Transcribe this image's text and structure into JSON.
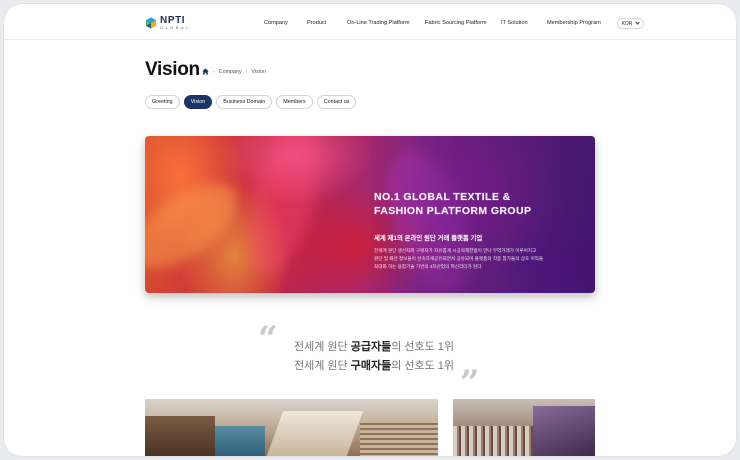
{
  "logo": {
    "name": "NPTI",
    "tagline": "GLOBAL"
  },
  "nav": {
    "items": [
      {
        "label": "Company"
      },
      {
        "label": "Product"
      },
      {
        "label": "On-Line Trading Platform"
      },
      {
        "label": "Fabric Sourcing Platform"
      },
      {
        "label": "IT Solution"
      },
      {
        "label": "Membership Program"
      }
    ],
    "language": "KOR"
  },
  "page": {
    "title": "Vision",
    "breadcrumb": [
      "Company",
      "Vision"
    ]
  },
  "tabs": [
    {
      "label": "Greeting",
      "active": false
    },
    {
      "label": "Vision",
      "active": true
    },
    {
      "label": "Business Domain",
      "active": false
    },
    {
      "label": "Members",
      "active": false
    },
    {
      "label": "Contact us",
      "active": false
    }
  ],
  "hero": {
    "title_line1": "NO.1 GLOBAL TEXTILE &",
    "title_line2": "FASHION PLATFORM GROUP",
    "subtitle": "세계 제1의 온라인 원단 거래 플랫폼 기업",
    "desc_line1": "전세계 원단 생산자와 구매자가 자유롭게 시공의제한없이 만나 무역거래가 이루어지고",
    "desc_line2": "원단 및 패션 정보들이 신속하게공유되면서 공유되며 플랫폼의 각종 참가들의 상호 이익을",
    "desc_line3": "최대화 하는 융합기술 기반의 4차산업의 혁신리더가 된다"
  },
  "quote": {
    "open_mark": "“",
    "close_mark": "”",
    "line1_prefix": "전세계 원단 ",
    "line1_bold": "공급자들",
    "line1_suffix": "의 선호도 1위",
    "line2_prefix": "전세계 원단 ",
    "line2_bold": "구매자들",
    "line2_suffix": "의 선호도 1위"
  },
  "colors": {
    "brand_navy": "#1c3566",
    "quote_mark": "#c9c9c9"
  }
}
